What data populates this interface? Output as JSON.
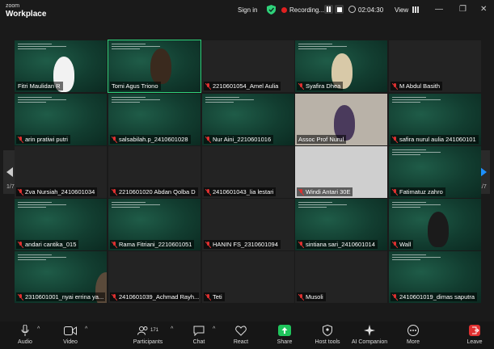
{
  "brand": {
    "line1": "zoom",
    "line2": "Workplace"
  },
  "topbar": {
    "sign_in": "Sign in",
    "recording": "Recording...",
    "timer": "02:04:30",
    "view": "View"
  },
  "pagination": {
    "left": "1/7",
    "right": "1/7"
  },
  "participants": [
    {
      "name": "Fitri Maulidan R",
      "bg": "green",
      "muted": false
    },
    {
      "name": "Tomi Agus Triono",
      "bg": "green",
      "muted": false
    },
    {
      "name": "2210601054_Amel Aulia",
      "bg": "dark",
      "muted": true
    },
    {
      "name": "Syafira Dhea",
      "bg": "green",
      "muted": true
    },
    {
      "name": "M Abdul Basith",
      "bg": "dark",
      "muted": true
    },
    {
      "name": "arin pratiwi putri",
      "bg": "green",
      "muted": true
    },
    {
      "name": "salsabilah.p_2410601028",
      "bg": "green",
      "muted": true
    },
    {
      "name": "Nur Aini_2210601016",
      "bg": "green",
      "muted": true
    },
    {
      "name": "Assoc Prof Nurul",
      "bg": "video",
      "muted": false
    },
    {
      "name": "safira nurul aulia 241060101",
      "bg": "green",
      "muted": true
    },
    {
      "name": "Zva Nursiah_2410601034",
      "bg": "dark",
      "muted": true
    },
    {
      "name": "2210601020 Abdan Qolba D",
      "bg": "dark",
      "muted": true
    },
    {
      "name": "2410601043_lia lestari",
      "bg": "dark",
      "muted": true
    },
    {
      "name": "Windi Antari 30E",
      "bg": "gray",
      "muted": true
    },
    {
      "name": "Fatimatuz zahro",
      "bg": "green",
      "muted": true
    },
    {
      "name": "andari cantika_015",
      "bg": "green",
      "muted": true
    },
    {
      "name": "Rama Fitriani_2210601051",
      "bg": "green",
      "muted": true
    },
    {
      "name": "HANIN FS_2310601094",
      "bg": "dark",
      "muted": true
    },
    {
      "name": "sintiana sari_2410601014",
      "bg": "green",
      "muted": true
    },
    {
      "name": "Wall",
      "bg": "green",
      "muted": true
    },
    {
      "name": "2310601001_nyai errina ya...",
      "bg": "green",
      "muted": true
    },
    {
      "name": "2410601039_Achmad Rayh...",
      "bg": "dark",
      "muted": true
    },
    {
      "name": "Teti",
      "bg": "dark",
      "muted": true
    },
    {
      "name": "Musoli",
      "bg": "dark",
      "muted": true
    },
    {
      "name": "2410601019_dimas saputra",
      "bg": "green",
      "muted": true
    }
  ],
  "toolbar": {
    "audio": "Audio",
    "video": "Video",
    "participants": "Participants",
    "participant_count": "171",
    "chat": "Chat",
    "react": "React",
    "share": "Share",
    "host_tools": "Host tools",
    "ai_companion": "AI Companion",
    "more": "More",
    "leave": "Leave"
  },
  "colors": {
    "accent_green": "#2fd27a",
    "mute_red": "#e03030",
    "share_green": "#1fc45c"
  }
}
